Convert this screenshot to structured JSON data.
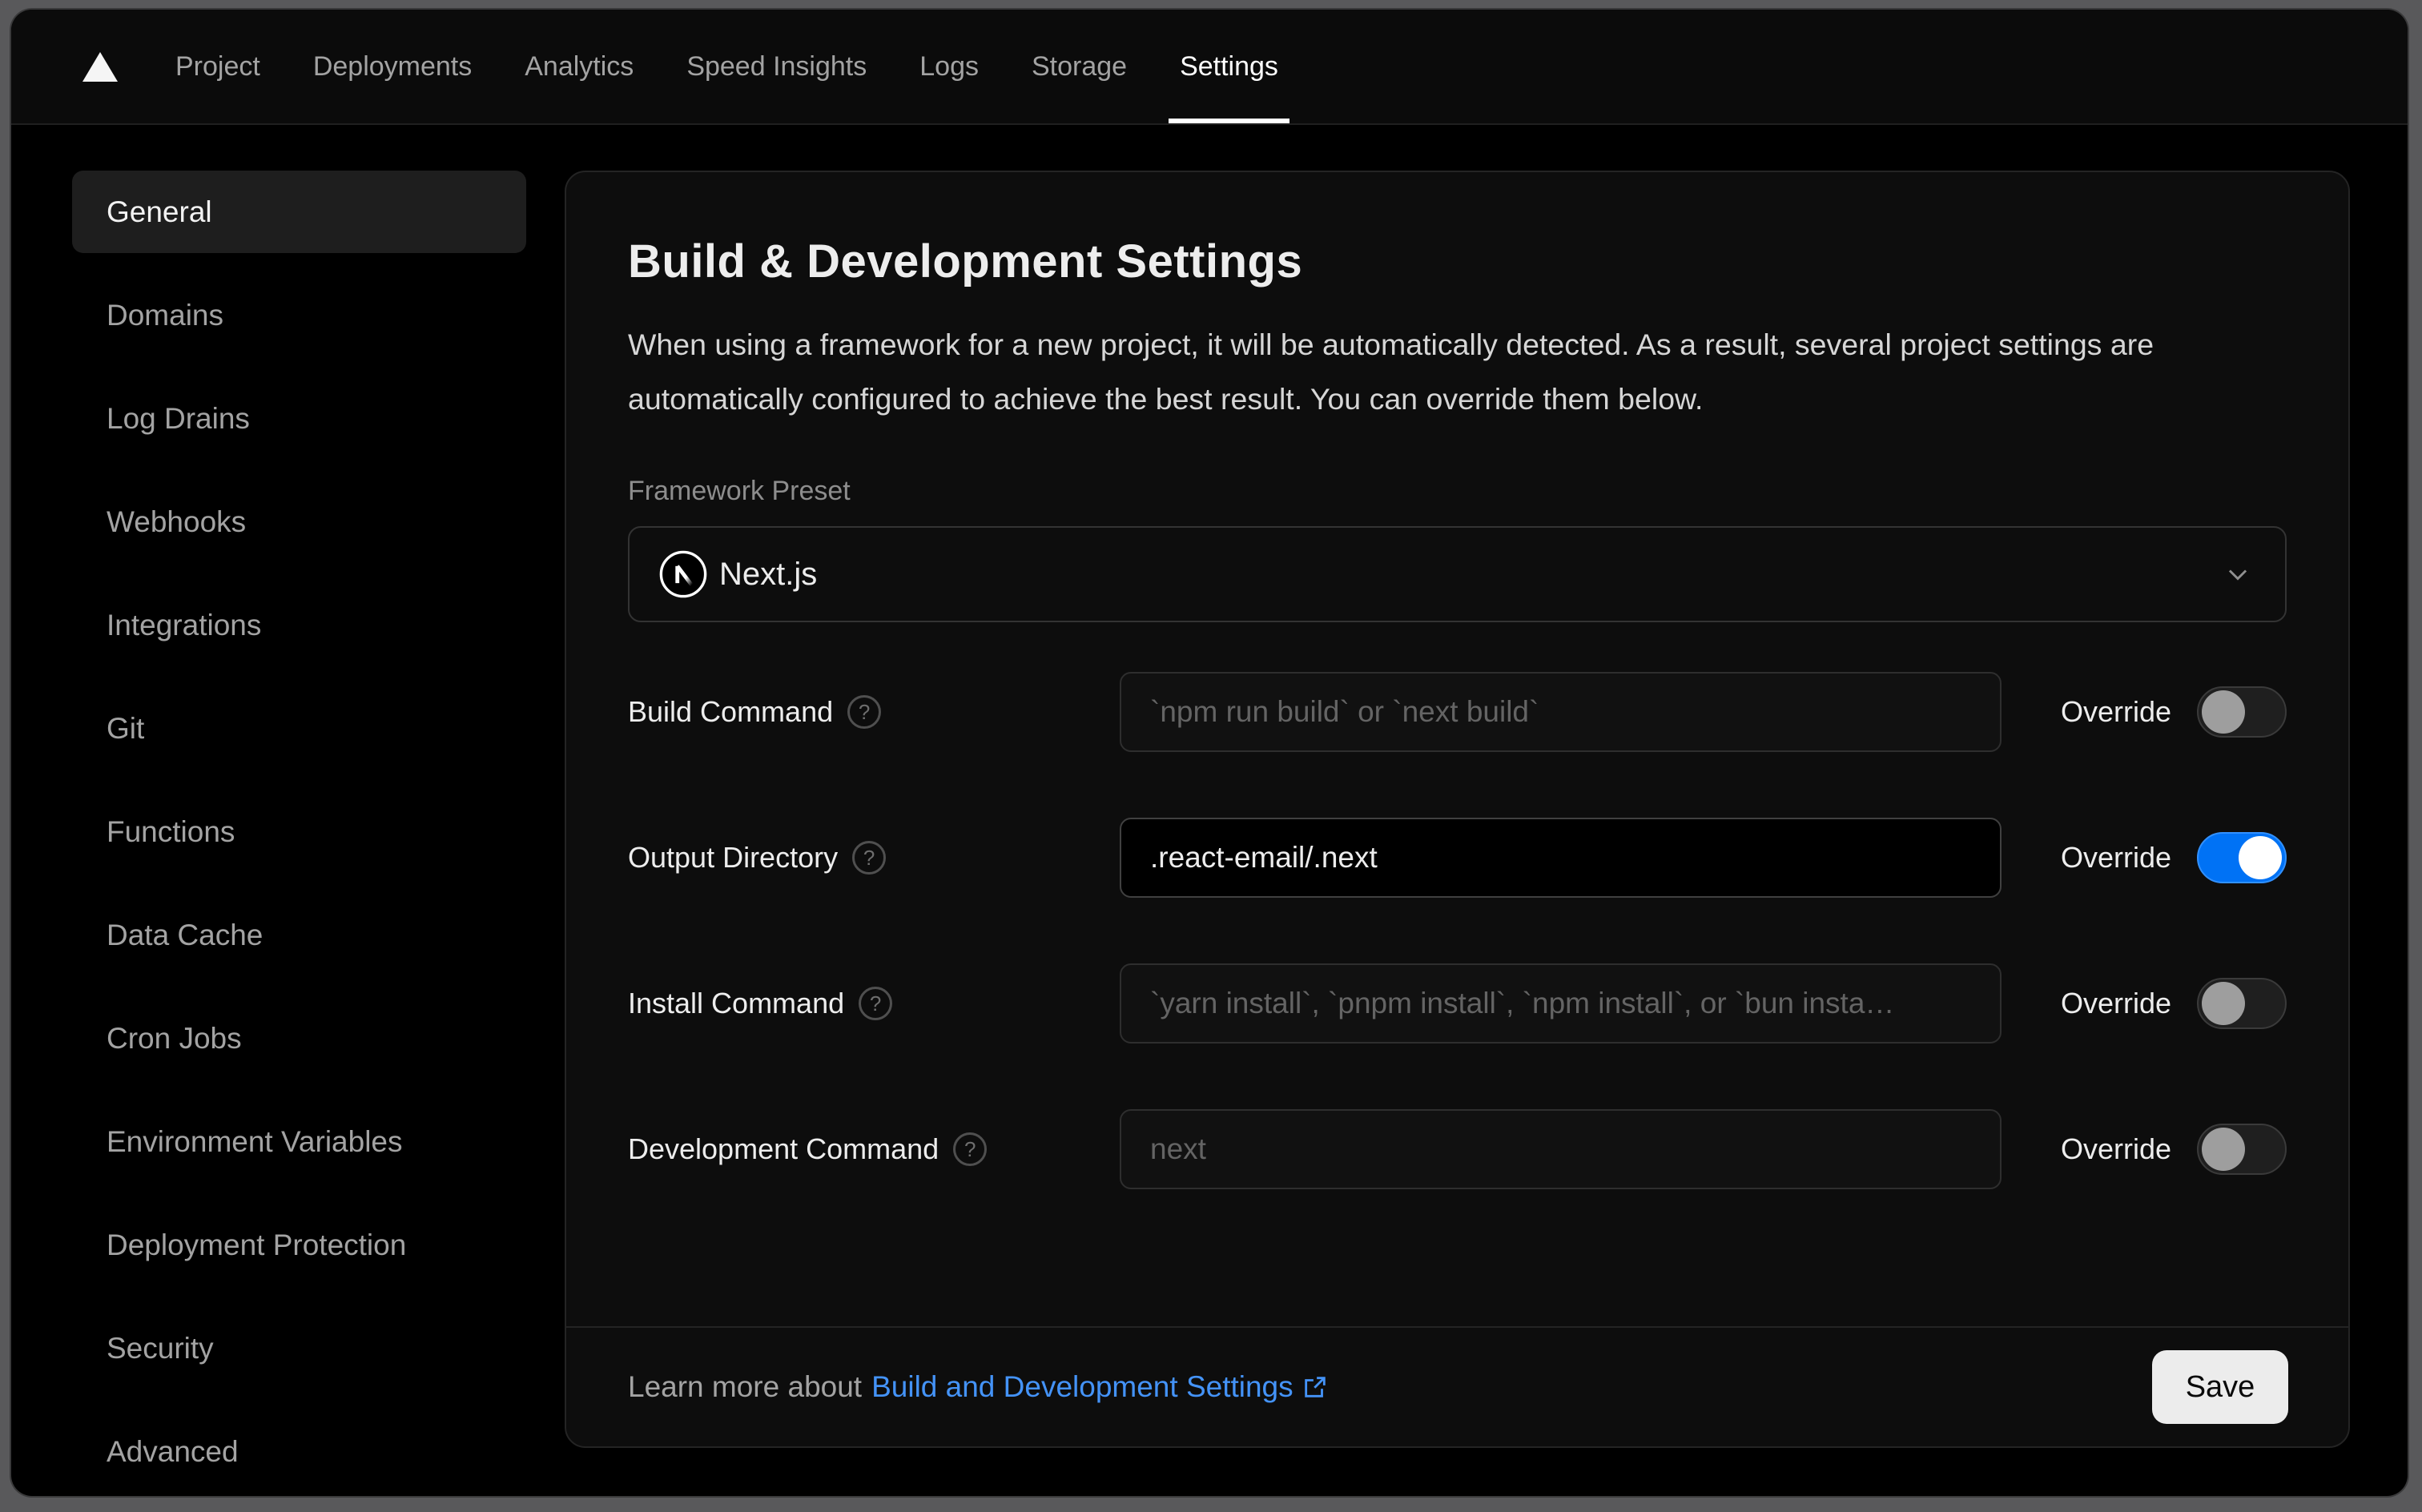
{
  "nav": {
    "items": [
      {
        "label": "Project",
        "active": false
      },
      {
        "label": "Deployments",
        "active": false
      },
      {
        "label": "Analytics",
        "active": false
      },
      {
        "label": "Speed Insights",
        "active": false
      },
      {
        "label": "Logs",
        "active": false
      },
      {
        "label": "Storage",
        "active": false
      },
      {
        "label": "Settings",
        "active": true
      }
    ]
  },
  "sidebar": {
    "items": [
      {
        "label": "General",
        "active": true
      },
      {
        "label": "Domains",
        "active": false
      },
      {
        "label": "Log Drains",
        "active": false
      },
      {
        "label": "Webhooks",
        "active": false
      },
      {
        "label": "Integrations",
        "active": false
      },
      {
        "label": "Git",
        "active": false
      },
      {
        "label": "Functions",
        "active": false
      },
      {
        "label": "Data Cache",
        "active": false
      },
      {
        "label": "Cron Jobs",
        "active": false
      },
      {
        "label": "Environment Variables",
        "active": false
      },
      {
        "label": "Deployment Protection",
        "active": false
      },
      {
        "label": "Security",
        "active": false
      },
      {
        "label": "Advanced",
        "active": false
      }
    ]
  },
  "card": {
    "title": "Build & Development Settings",
    "description": "When using a framework for a new project, it will be automatically detected. As a result, several project settings are automatically configured to achieve the best result. You can override them below.",
    "framework": {
      "label": "Framework Preset",
      "value": "Next.js"
    },
    "override_label": "Override",
    "rows": [
      {
        "label": "Build Command",
        "placeholder": "`npm run build` or `next build`",
        "value": "",
        "override": false
      },
      {
        "label": "Output Directory",
        "placeholder": "",
        "value": ".react-email/.next",
        "override": true
      },
      {
        "label": "Install Command",
        "placeholder": "`yarn install`, `pnpm install`, `npm install`, or `bun insta…",
        "value": "",
        "override": false
      },
      {
        "label": "Development Command",
        "placeholder": "next",
        "value": "",
        "override": false
      }
    ],
    "footer": {
      "prefix": "Learn more about",
      "link_label": "Build and Development Settings",
      "save_label": "Save"
    }
  },
  "colors": {
    "accent_blue": "#0072f5",
    "link_blue": "#4493f8",
    "frame_gray": "#59595b",
    "card_bg": "#0d0d0d",
    "save_bg": "#ececec"
  }
}
